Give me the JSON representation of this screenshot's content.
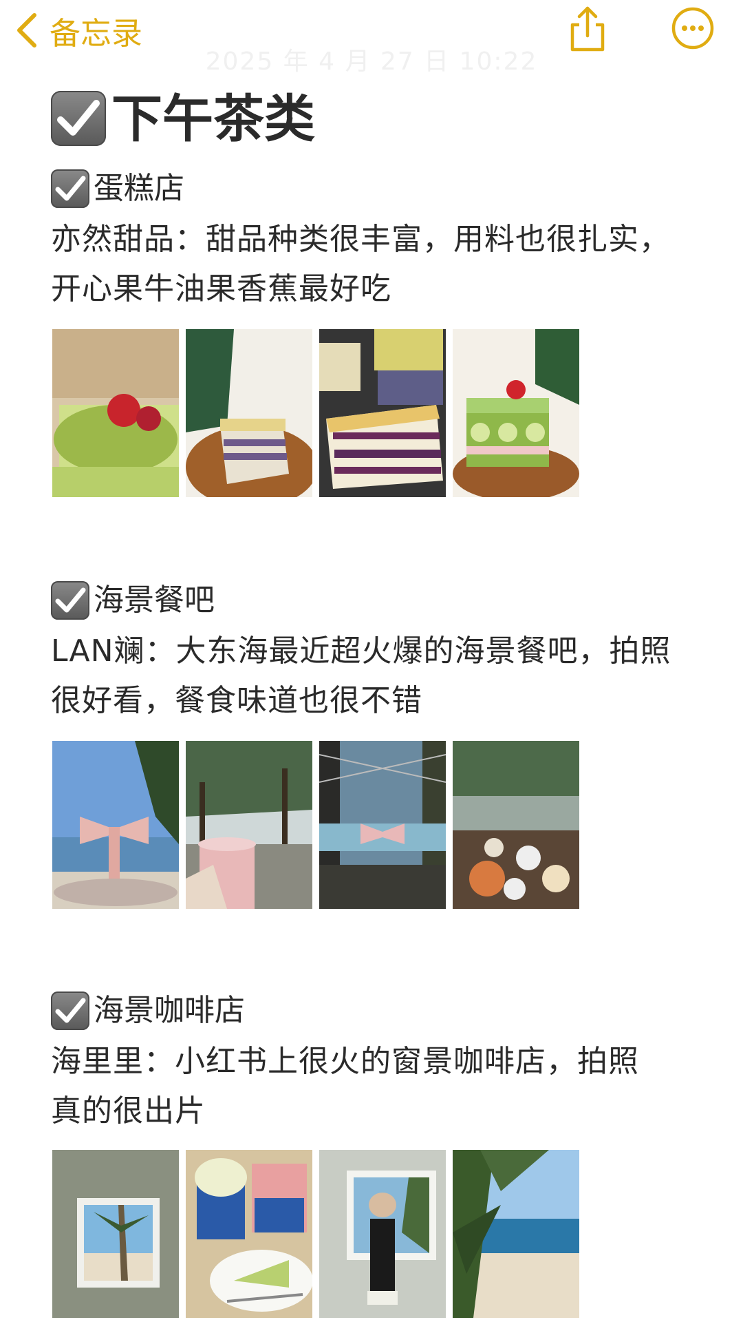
{
  "nav": {
    "back_label": "备忘录",
    "datetime": "2025 年 4 月 27 日 10:22"
  },
  "note": {
    "title": "下午茶类",
    "sections": [
      {
        "heading": "蛋糕店",
        "description_line1": "亦然甜品：甜品种类很丰富，用料也很扎实，",
        "description_line2": "开心果牛油果香蕉最好吃"
      },
      {
        "heading": "海景餐吧",
        "description_line1": "LAN斓：大东海最近超火爆的海景餐吧，拍照",
        "description_line2": "很好看，餐食味道也很不错"
      },
      {
        "heading": "海景咖啡店",
        "description_line1": "海里里：小红书上很火的窗景咖啡店，拍照",
        "description_line2": "真的很出片"
      }
    ]
  },
  "colors": {
    "accent": "#e0ac12",
    "text": "#2a2a2a",
    "checkbox": "#6b6b6b"
  },
  "icons": [
    "chevron-left-icon",
    "share-icon",
    "more-icon",
    "checkbox-checked-icon"
  ]
}
